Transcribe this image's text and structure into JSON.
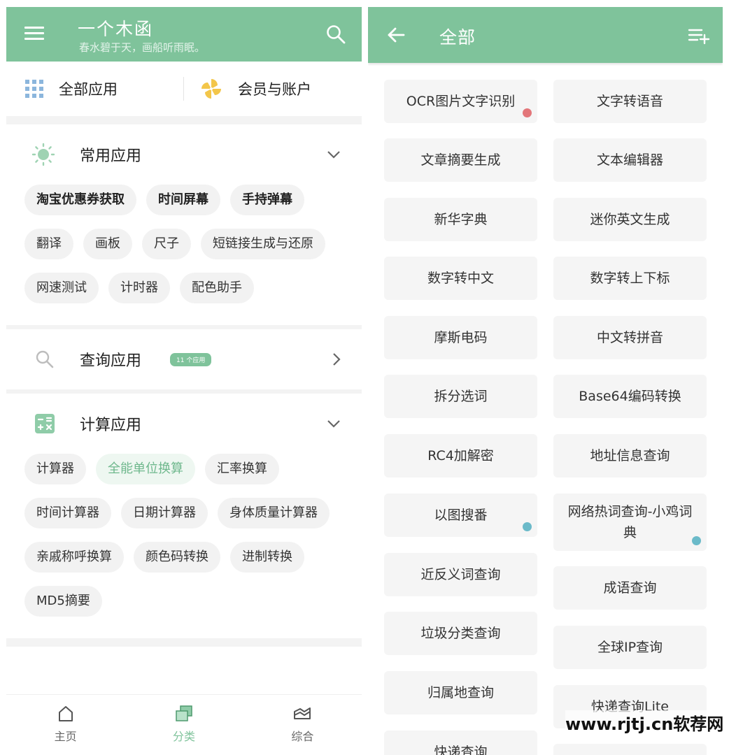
{
  "left": {
    "header": {
      "title": "一个木函",
      "subtitle": "春水碧于天，画船听雨眠。"
    },
    "quick": {
      "all_apps": "全部应用",
      "member": "会员与账户"
    },
    "common": {
      "title": "常用应用",
      "tags": [
        "淘宝优惠券获取",
        "时间屏幕",
        "手持弹幕",
        "翻译",
        "画板",
        "尺子",
        "短链接生成与还原",
        "网速测试",
        "计时器",
        "配色助手"
      ]
    },
    "query": {
      "title": "查询应用",
      "badge": "11 个应用"
    },
    "calc": {
      "title": "计算应用",
      "tags": [
        "计算器",
        "全能单位换算",
        "汇率换算",
        "时间计算器",
        "日期计算器",
        "身体质量计算器",
        "亲戚称呼换算",
        "颜色码转换",
        "进制转换",
        "MD5摘要"
      ]
    },
    "nav": {
      "home": "主页",
      "category": "分类",
      "general": "综合"
    }
  },
  "right": {
    "header": {
      "title": "全部"
    },
    "apps": [
      "OCR图片文字识别",
      "文字转语音",
      "文章摘要生成",
      "文本编辑器",
      "新华字典",
      "迷你英文生成",
      "数字转中文",
      "数字转上下标",
      "摩斯电码",
      "中文转拼音",
      "拆分选词",
      "Base64编码转换",
      "RC4加解密",
      "地址信息查询",
      "以图搜番",
      "网络热词查询-小鸡词典",
      "近反义词查询",
      "成语查询",
      "垃圾分类查询",
      "全球IP查询",
      "归属地查询",
      "快递查询Lite",
      "快递查询",
      ""
    ]
  },
  "colors": {
    "accent": "#7fc39b",
    "red_dot": "#e3767a",
    "blue_dot": "#6bbac9"
  },
  "watermark": "www.rjtj.cn软荐网"
}
